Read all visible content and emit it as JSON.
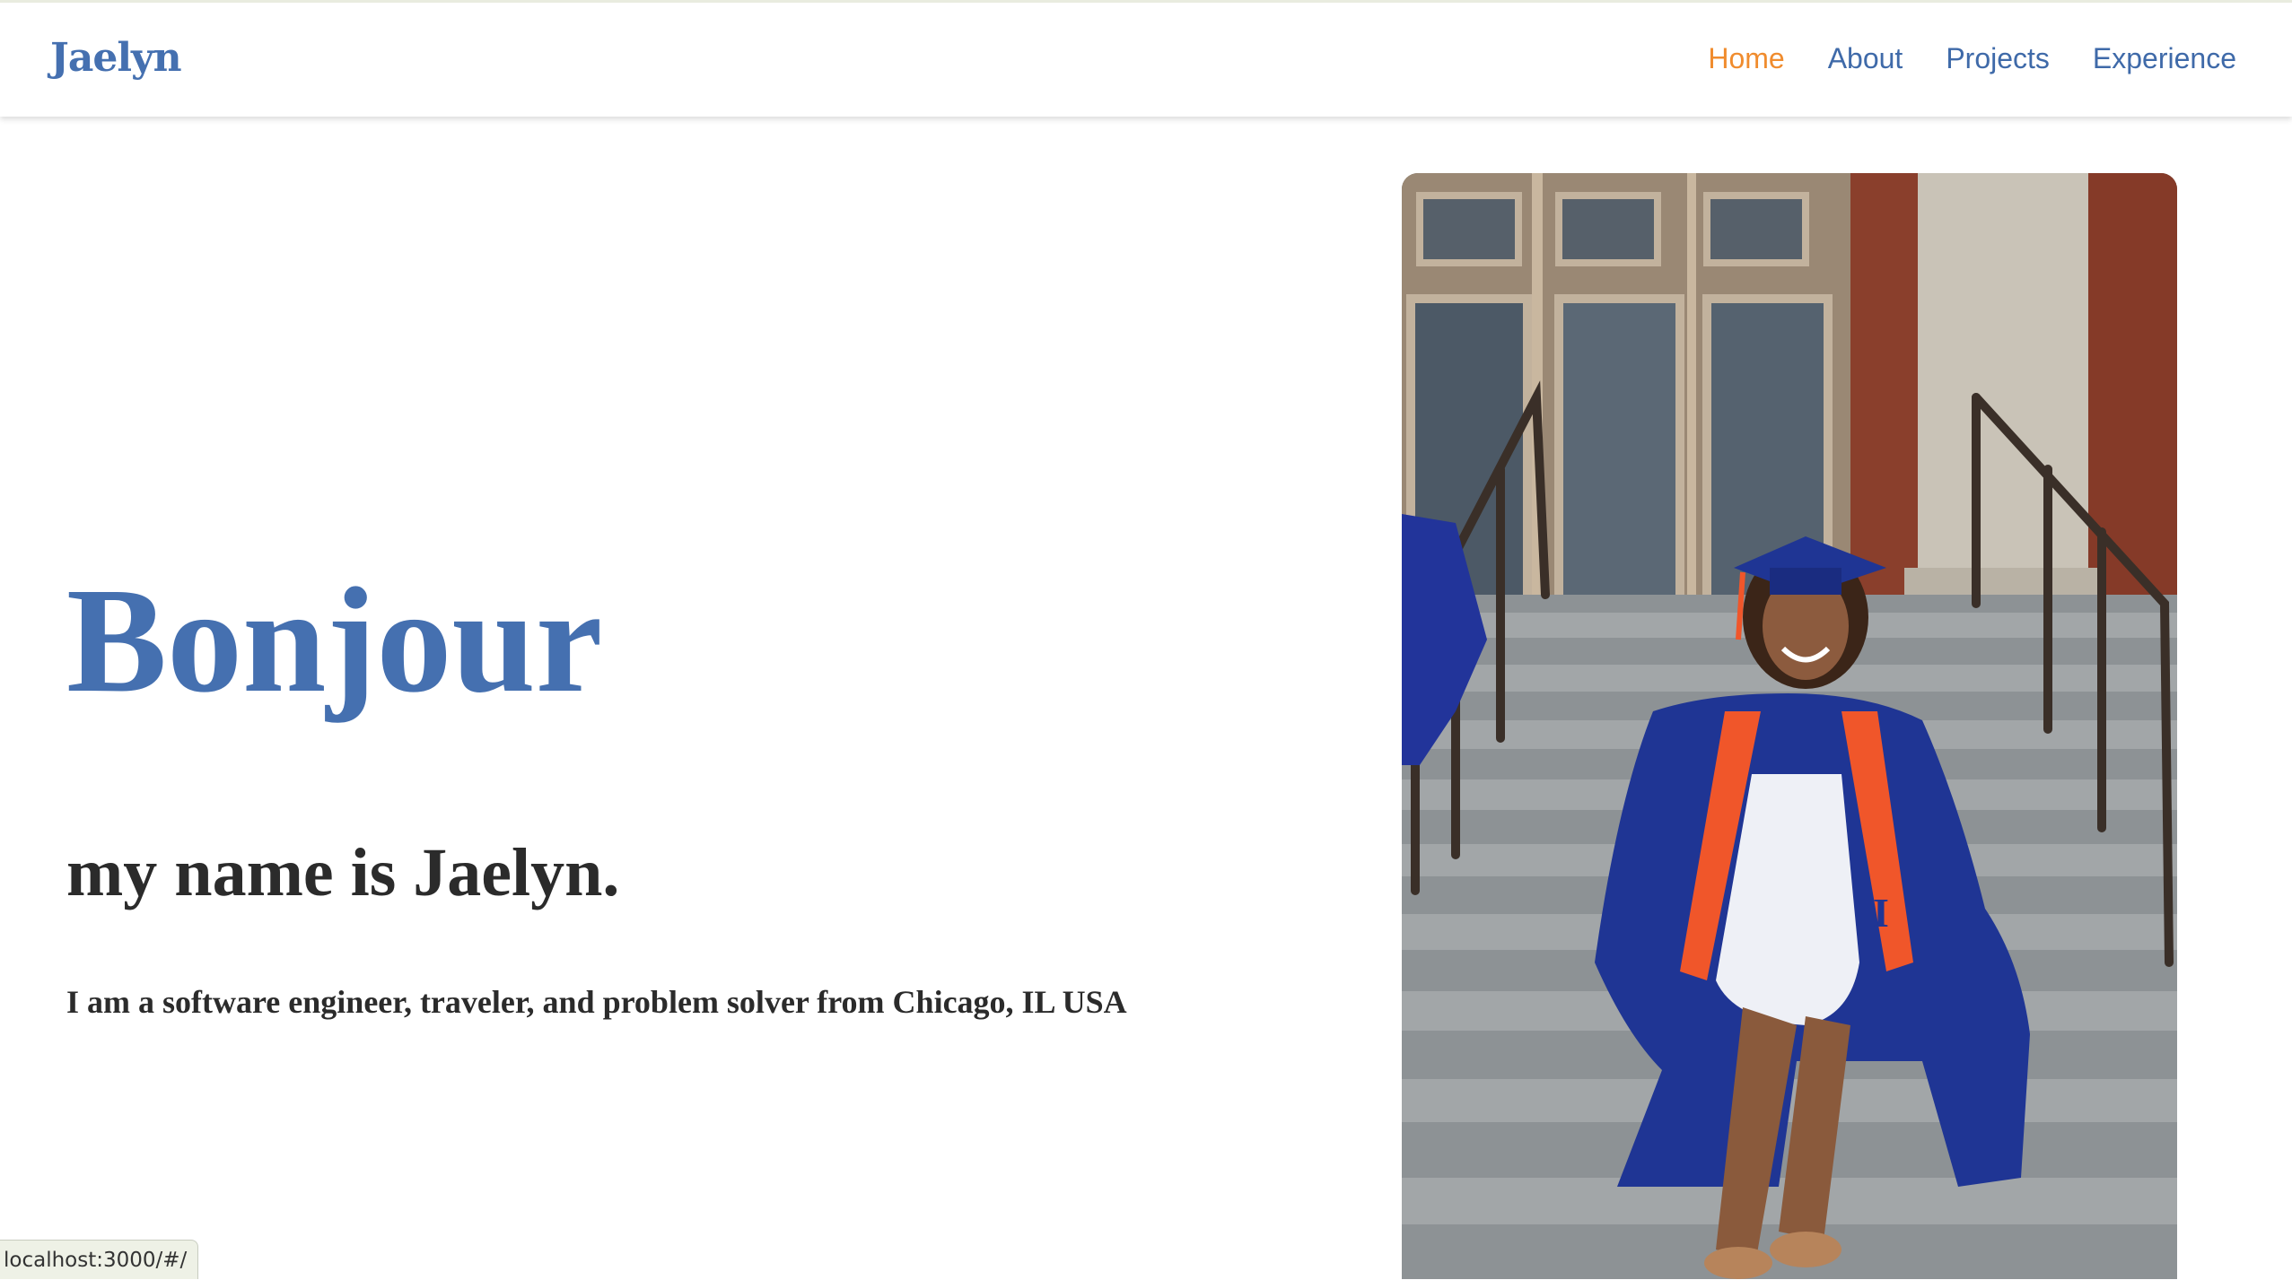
{
  "nav": {
    "brand": "Jaelyn",
    "links": [
      {
        "label": "Home",
        "active": true
      },
      {
        "label": "About",
        "active": false
      },
      {
        "label": "Projects",
        "active": false
      },
      {
        "label": "Experience",
        "active": false
      }
    ]
  },
  "hero": {
    "greeting": "Bonjour",
    "intro": "my name is Jaelyn.",
    "tagline": "I am a software engineer, traveler, and problem solver from Chicago, IL USA"
  },
  "photo": {
    "icon": "graduate-portrait-photo"
  },
  "status_bar": {
    "url": "localhost:3000/#/"
  },
  "colors": {
    "brand_blue": "#4570b0",
    "nav_blue": "#3f6aa9",
    "active_orange": "#f08c2e",
    "text_dark": "#2b2b2b"
  }
}
